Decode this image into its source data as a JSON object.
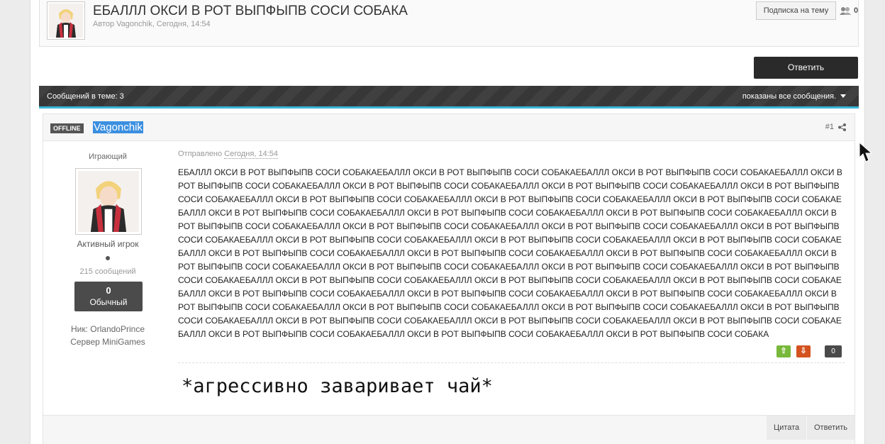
{
  "topic": {
    "title": "ЕБАЛЛЛ ОКСИ В РОТ ВЫПФЫПВ СОСИ СОБАКА",
    "meta": "Автор Vagonchik, Сегодня, 14:54",
    "follow_label": "Подписка на тему",
    "follow_count": "0",
    "reply_label": "Ответить"
  },
  "bar": {
    "posts_in_topic": "Сообщений в теме: 3",
    "filter_label": "показаны все сообщения."
  },
  "post": {
    "status": "OFFLINE",
    "author": "Vagonchik",
    "number": "#1",
    "posted_prefix": "Отправлено",
    "posted_time": "Сегодня, 14:54",
    "body": "ЕБАЛЛЛ ОКСИ В РОТ ВЫПФЫПВ СОСИ СОБАКАЕБАЛЛЛ ОКСИ В РОТ ВЫПФЫПВ СОСИ СОБАКАЕБАЛЛЛ ОКСИ В РОТ ВЫПФЫПВ СОСИ СОБАКАЕБАЛЛЛ ОКСИ В РОТ ВЫПФЫПВ СОСИ СОБАКАЕБАЛЛЛ ОКСИ В РОТ ВЫПФЫПВ СОСИ СОБАКАЕБАЛЛЛ ОКСИ В РОТ ВЫПФЫПВ СОСИ СОБАКАЕБАЛЛЛ ОКСИ В РОТ ВЫПФЫПВ СОСИ СОБАКАЕБАЛЛЛ ОКСИ В РОТ ВЫПФЫПВ СОСИ СОБАКАЕБАЛЛЛ ОКСИ В РОТ ВЫПФЫПВ СОСИ СОБАКАЕБАЛЛЛ ОКСИ В РОТ ВЫПФЫПВ СОСИ СОБАКАЕБАЛЛЛ ОКСИ В РОТ ВЫПФЫПВ СОСИ СОБАКАЕБАЛЛЛ ОКСИ В РОТ ВЫПФЫПВ СОСИ СОБАКАЕБАЛЛЛ ОКСИ В РОТ ВЫПФЫПВ СОСИ СОБАКАЕБАЛЛЛ ОКСИ В РОТ ВЫПФЫПВ СОСИ СОБАКАЕБАЛЛЛ ОКСИ В РОТ ВЫПФЫПВ СОСИ СОБАКАЕБАЛЛЛ ОКСИ В РОТ ВЫПФЫПВ СОСИ СОБАКАЕБАЛЛЛ ОКСИ В РОТ ВЫПФЫПВ СОСИ СОБАКАЕБАЛЛЛ ОКСИ В РОТ ВЫПФЫПВ СОСИ СОБАКАЕБАЛЛЛ ОКСИ В РОТ ВЫПФЫПВ СОСИ СОБАКАЕБАЛЛЛ ОКСИ В РОТ ВЫПФЫПВ СОСИ СОБАКАЕБАЛЛЛ ОКСИ В РОТ ВЫПФЫПВ СОСИ СОБАКАЕБАЛЛЛ ОКСИ В РОТ ВЫПФЫПВ СОСИ СОБАКАЕБАЛЛЛ ОКСИ В РОТ ВЫПФЫПВ СОСИ СОБАКАЕБАЛЛЛ ОКСИ В РОТ ВЫПФЫПВ СОСИ СОБАКАЕБАЛЛЛ ОКСИ В РОТ ВЫПФЫПВ СОСИ СОБАКАЕБАЛЛЛ ОКСИ В РОТ ВЫПФЫПВ СОСИ СОБАКАЕБАЛЛЛ ОКСИ В РОТ ВЫПФЫПВ СОСИ СОБАКАЕБАЛЛЛ ОКСИ В РОТ ВЫПФЫПВ СОСИ СОБАКАЕБАЛЛЛ ОКСИ В РОТ ВЫПФЫПВ СОСИ СОБАКАЕБАЛЛЛ ОКСИ В РОТ ВЫПФЫПВ СОСИ СОБАКАЕБАЛЛЛ ОКСИ В РОТ ВЫПФЫПВ СОСИ СОБАКАЕБАЛЛЛ ОКСИ В РОТ ВЫПФЫПВ СОСИ СОБАКАЕБАЛЛЛ ОКСИ В РОТ ВЫПФЫПВ СОСИ СОБАКАЕБАЛЛЛ ОКСИ В РОТ ВЫПФЫПВ СОСИ СОБАКАЕБАЛЛЛ ОКСИ В РОТ ВЫПФЫПВ СОСИ СОБАКАЕБАЛЛЛ ОКСИ В РОТ ВЫПФЫПВ СОСИ СОБАКАЕБАЛЛЛ ОКСИ В РОТ ВЫПФЫПВ СОСИ СОБАКАЕБАЛЛЛ ОКСИ В РОТ ВЫПФЫПВ СОСИ СОБАКАЕБАЛЛЛ ОКСИ В РОТ ВЫПФЫПВ СОСИ СОБАКАЕБАЛЛЛ ОКСИ В РОТ ВЫПФЫПВ СОСИ СОБАКАЕБАЛЛЛ ОКСИ В РОТ ВЫПФЫПВ СОСИ СОБАКАЕБАЛЛЛ ОКСИ В РОТ ВЫПФЫПВ СОСИ СОБАКАЕБАЛЛЛ ОКСИ В РОТ ВЫПФЫПВ СОСИ СОБАКА",
    "signature": "*агрессивно заваривает чай*",
    "vote_up": "⇧",
    "vote_down": "⇩",
    "vote_count": "0",
    "quote_label": "Цитата",
    "reply_label": "Ответить"
  },
  "author_info": {
    "group": "Играющий",
    "rank": "Активный игрок",
    "post_count": "215 сообщений",
    "reputation_value": "0",
    "reputation_label": "Обычный",
    "nick": "Ник: OrlandoPrince",
    "server": "Сервер MiniGames"
  },
  "colors": {
    "accent": "#3ab5d8",
    "vote_up": "#78b83a",
    "vote_down": "#d4521f",
    "selection": "#3b8fe0"
  }
}
